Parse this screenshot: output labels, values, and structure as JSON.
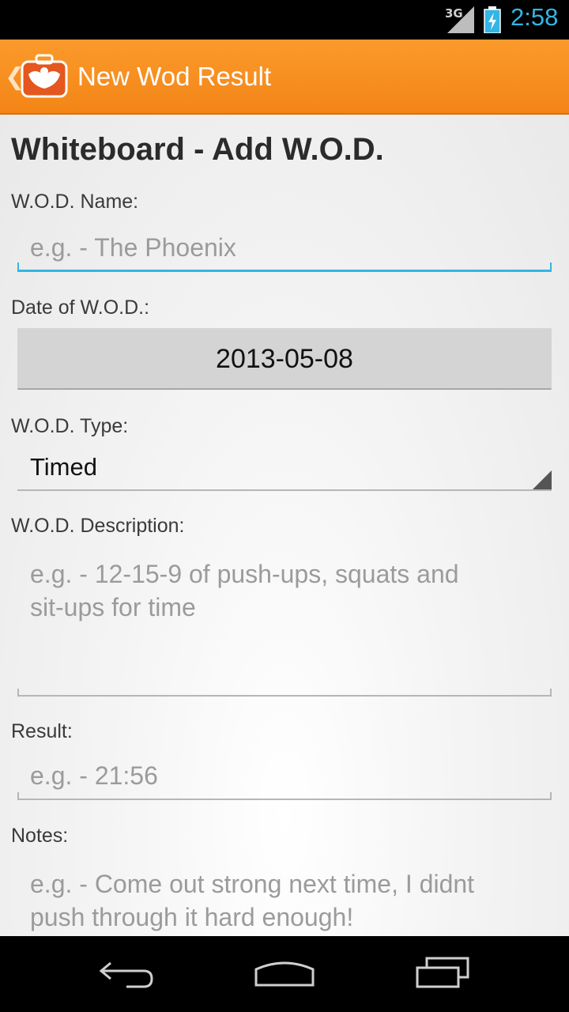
{
  "status_bar": {
    "network": "3G",
    "time": "2:58",
    "icons": [
      "signal-icon",
      "battery-charging-icon"
    ]
  },
  "action_bar": {
    "title": "New Wod Result",
    "icons": [
      "up-caret-icon",
      "app-logo-icon"
    ]
  },
  "form": {
    "heading": "Whiteboard - Add W.O.D.",
    "wod_name": {
      "label": "W.O.D. Name:",
      "placeholder": "e.g. - The Phoenix"
    },
    "date": {
      "label": "Date of W.O.D.:",
      "value": "2013-05-08"
    },
    "type": {
      "label": "W.O.D. Type:",
      "value": "Timed"
    },
    "description": {
      "label": "W.O.D. Description:",
      "placeholder_line1": "e.g. - 12-15-9 of push-ups, squats and",
      "placeholder_line2": "sit-ups for time"
    },
    "result": {
      "label": "Result:",
      "placeholder": "e.g. - 21:56"
    },
    "notes": {
      "label": "Notes:",
      "placeholder_line1": "e.g. - Come out strong next time, I didnt",
      "placeholder_line2": "push through it hard enough!"
    }
  },
  "nav_bar": {
    "icons": [
      "back-icon",
      "home-icon",
      "recent-apps-icon"
    ]
  },
  "colors": {
    "accent": "#33b5e5",
    "action_bar": "#f7901e"
  }
}
